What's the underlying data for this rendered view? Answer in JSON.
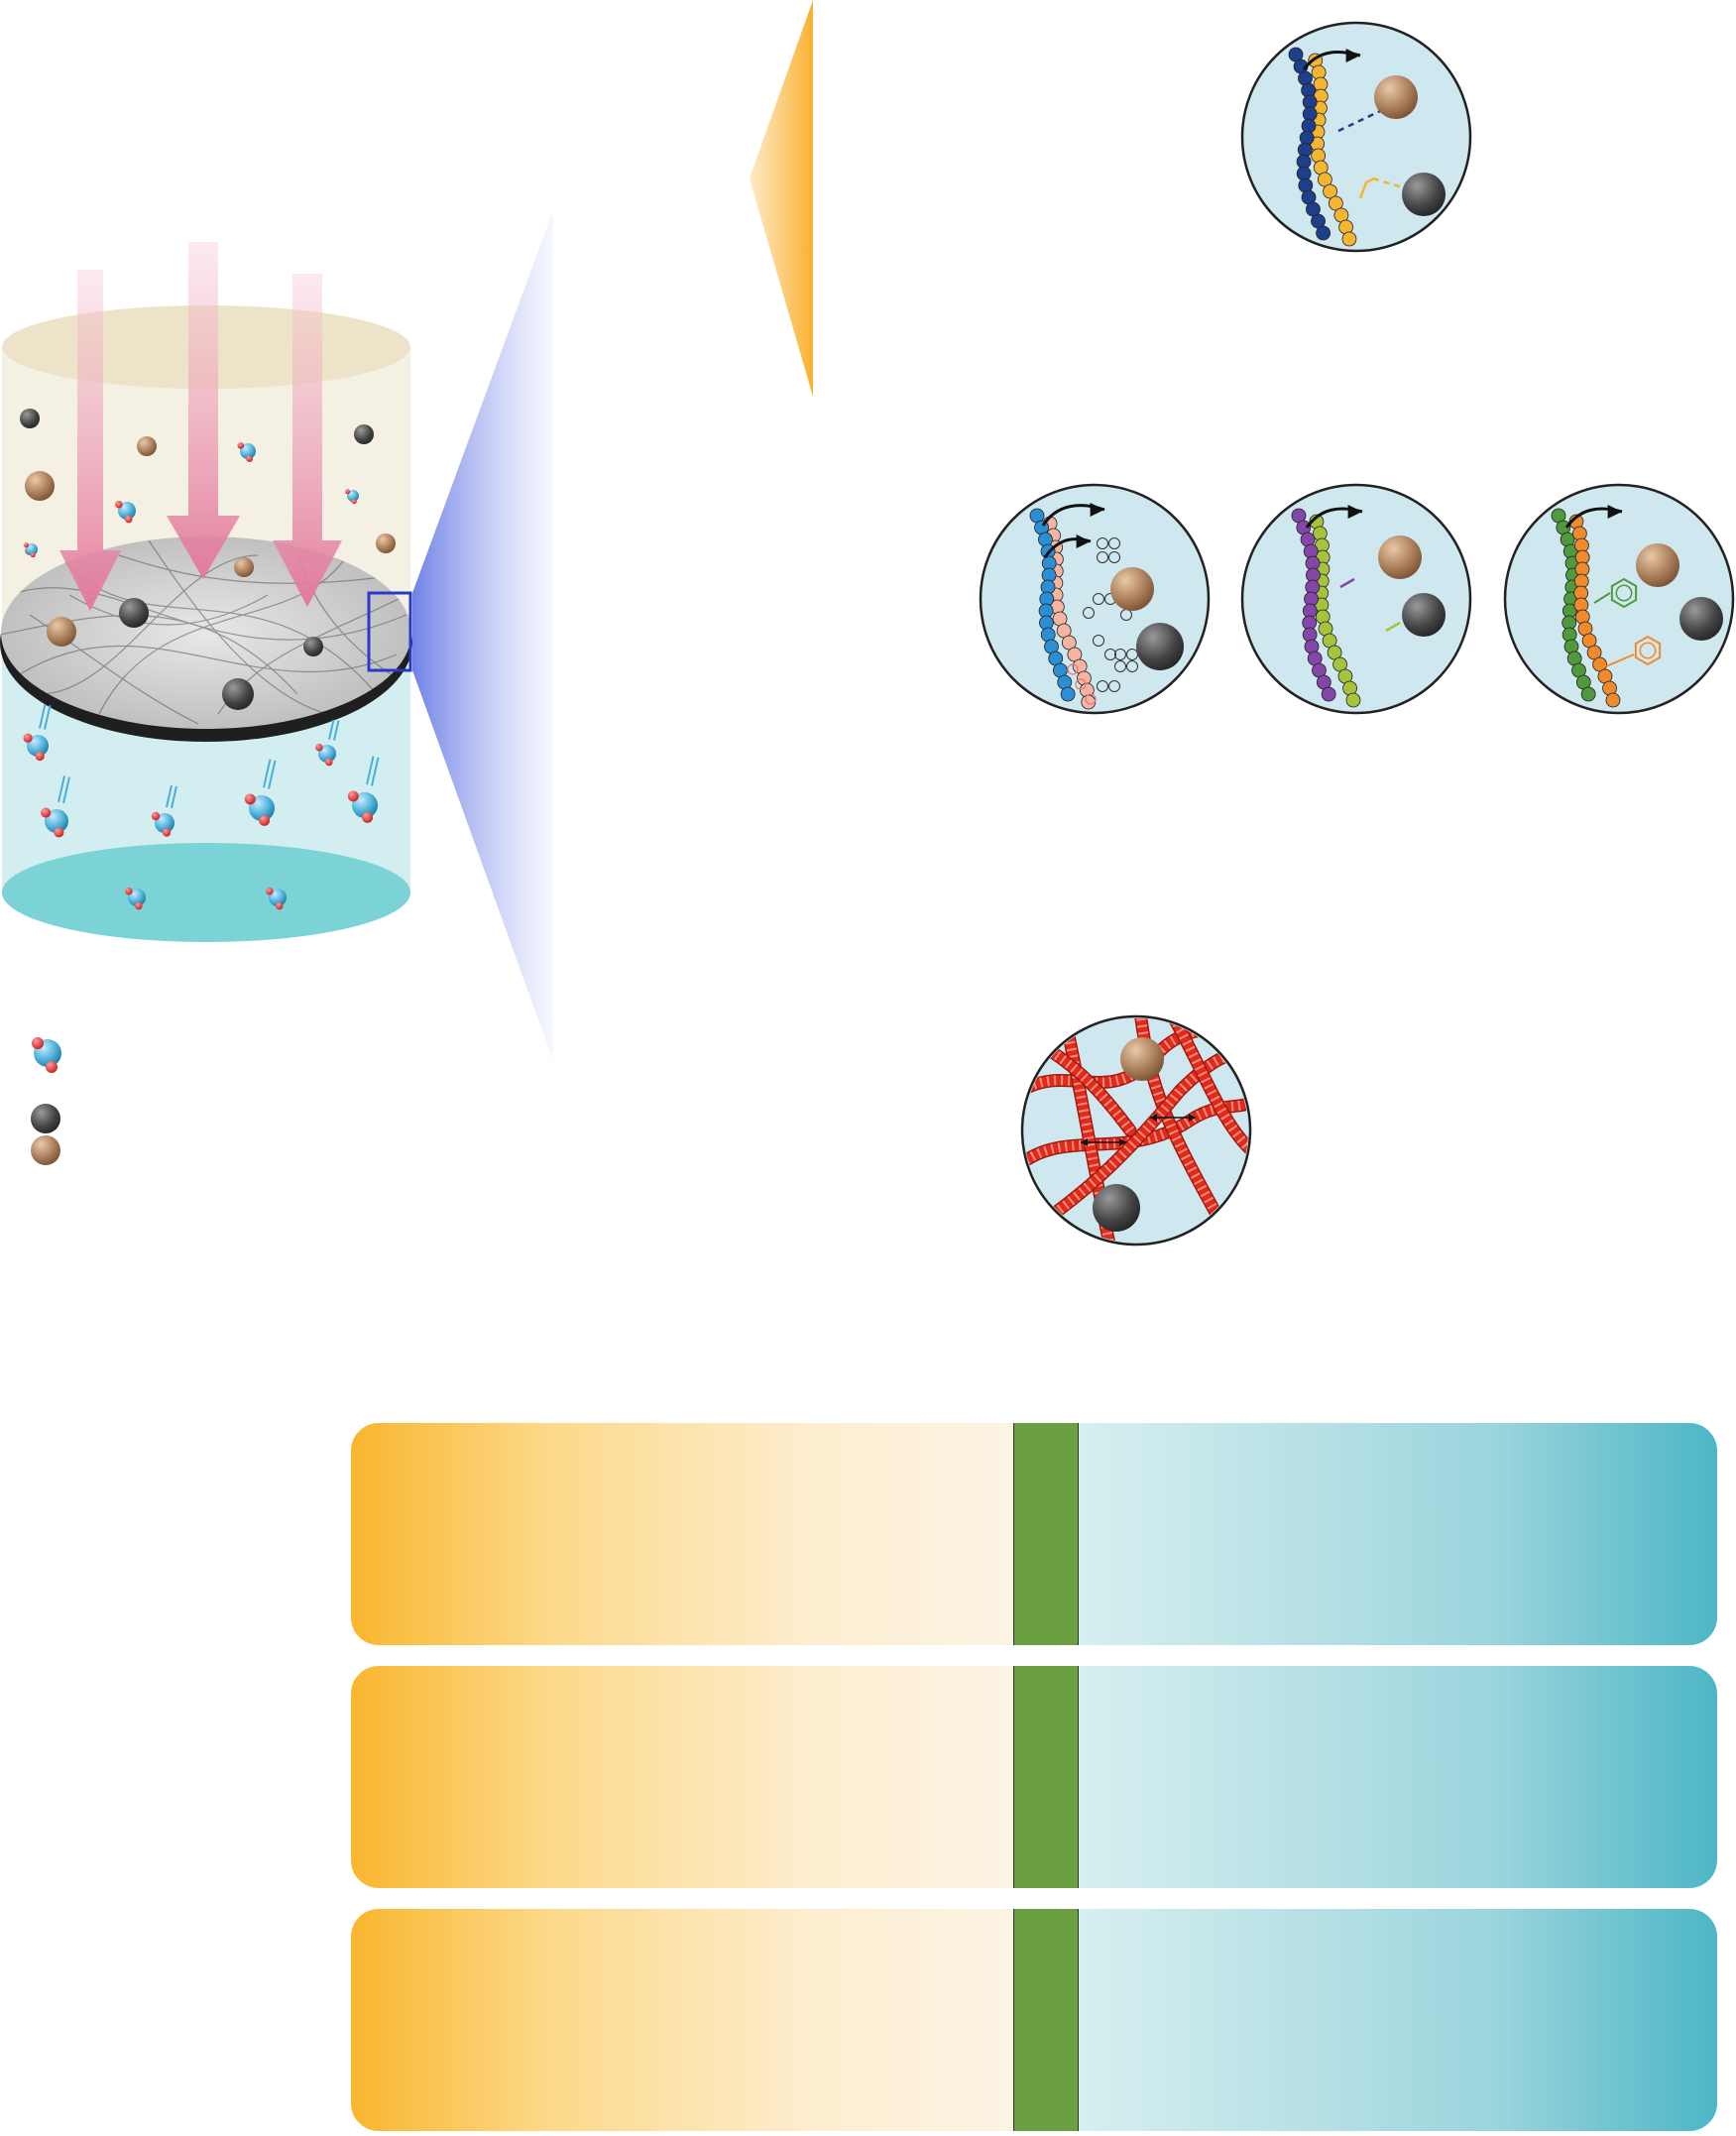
{
  "colors": {
    "water_light": "#d3eef0",
    "water_dark": "#7bd3d5",
    "feed_top": "#ede3c8",
    "feed_body": "#f5f0e4",
    "membrane": "#d9d9d9",
    "membrane_rim": "#333333",
    "blue_box": "#2b39c9",
    "brown_solute": "#a77a56",
    "dark_solute": "#4a4a4a",
    "water_molecule": "#4ab0d8",
    "oxygen_red": "#e12a2a",
    "inset_bg": "#cfe7ee",
    "orange_fan": "#f9b12f",
    "blue_fan": "#aab6ee",
    "bar_green": "#6aa042",
    "bar_orange": "#f9b62e",
    "bar_teal": "#4db6c6"
  },
  "legend": {
    "items": [
      {
        "icon": "water-molecule-icon"
      },
      {
        "icon": "dark-solute-icon"
      },
      {
        "icon": "brown-solute-icon"
      }
    ]
  },
  "insets": [
    {
      "name": "inset-charge-interaction",
      "chain_a": "#1d3f8c",
      "chain_b": "#f4b632"
    },
    {
      "name": "inset-hydration",
      "chain_a": "#2b8fd6",
      "chain_b": "#f6b4a1"
    },
    {
      "name": "inset-hydrogen-bond",
      "chain_a": "#8447a9",
      "chain_b": "#a5c43c"
    },
    {
      "name": "inset-pi-interaction",
      "chain_a": "#4f9a3d",
      "chain_b": "#f08a2b"
    },
    {
      "name": "inset-size-exclusion",
      "fiber": "#e02a1c"
    }
  ],
  "bars": [
    {
      "name": "comparison-bar-1"
    },
    {
      "name": "comparison-bar-2"
    },
    {
      "name": "comparison-bar-3"
    }
  ]
}
